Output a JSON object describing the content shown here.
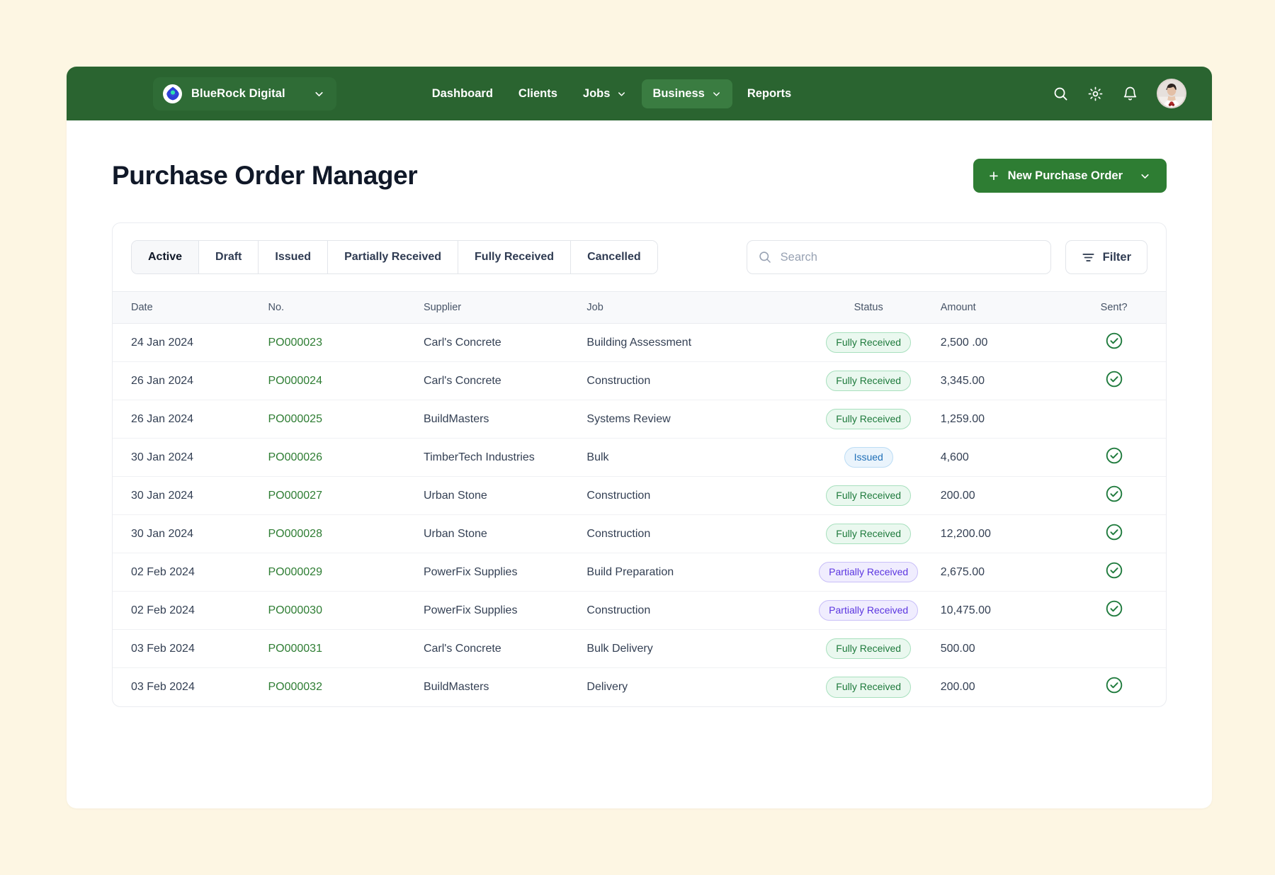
{
  "brand": {
    "name": "BlueRock Digital",
    "logo_icon": "bluerock-logo-icon",
    "caret_icon": "chevron-down-icon"
  },
  "nav": {
    "items": [
      {
        "label": "Dashboard",
        "has_caret": false,
        "active": false
      },
      {
        "label": "Clients",
        "has_caret": false,
        "active": false
      },
      {
        "label": "Jobs",
        "has_caret": true,
        "active": false
      },
      {
        "label": "Business",
        "has_caret": true,
        "active": true
      },
      {
        "label": "Reports",
        "has_caret": false,
        "active": false
      }
    ],
    "right_icons": [
      "search-icon",
      "gear-icon",
      "bell-icon"
    ],
    "avatar": "user-avatar"
  },
  "header": {
    "title": "Purchase Order Manager",
    "new_button_label": "New Purchase Order",
    "new_button_plus": "+",
    "accent_green": "#2E7D33"
  },
  "toolbar": {
    "tabs": [
      {
        "label": "Active",
        "active": true
      },
      {
        "label": "Draft",
        "active": false
      },
      {
        "label": "Issued",
        "active": false
      },
      {
        "label": "Partially Received",
        "active": false
      },
      {
        "label": "Fully Received",
        "active": false
      },
      {
        "label": "Cancelled",
        "active": false
      }
    ],
    "search_placeholder": "Search",
    "search_value": "",
    "filter_label": "Filter"
  },
  "table": {
    "columns": [
      "Date",
      "No.",
      "Supplier",
      "Job",
      "Status",
      "Amount",
      "Sent?"
    ],
    "rows": [
      {
        "date": "24 Jan 2024",
        "no": "PO000023",
        "supplier": "Carl's Concrete",
        "job": "Building Assessment",
        "status": "Fully Received",
        "status_kind": "fully",
        "amount": "2,500 .00",
        "sent": true
      },
      {
        "date": "26 Jan 2024",
        "no": "PO000024",
        "supplier": "Carl's Concrete",
        "job": "Construction",
        "status": "Fully Received",
        "status_kind": "fully",
        "amount": "3,345.00",
        "sent": true
      },
      {
        "date": "26 Jan 2024",
        "no": "PO000025",
        "supplier": "BuildMasters",
        "job": "Systems Review",
        "status": "Fully Received",
        "status_kind": "fully",
        "amount": "1,259.00",
        "sent": false
      },
      {
        "date": "30 Jan 2024",
        "no": "PO000026",
        "supplier": "TimberTech Industries",
        "job": "Bulk",
        "status": "Issued",
        "status_kind": "issued",
        "amount": "4,600",
        "sent": true
      },
      {
        "date": "30 Jan 2024",
        "no": "PO000027",
        "supplier": "Urban Stone",
        "job": "Construction",
        "status": "Fully Received",
        "status_kind": "fully",
        "amount": "200.00",
        "sent": true
      },
      {
        "date": "30 Jan 2024",
        "no": "PO000028",
        "supplier": "Urban Stone",
        "job": "Construction",
        "status": "Fully Received",
        "status_kind": "fully",
        "amount": "12,200.00",
        "sent": true
      },
      {
        "date": "02 Feb 2024",
        "no": "PO000029",
        "supplier": "PowerFix Supplies",
        "job": "Build Preparation",
        "status": "Partially Received",
        "status_kind": "partially",
        "amount": "2,675.00",
        "sent": true
      },
      {
        "date": "02 Feb 2024",
        "no": "PO000030",
        "supplier": "PowerFix Supplies",
        "job": "Construction",
        "status": "Partially Received",
        "status_kind": "partially",
        "amount": "10,475.00",
        "sent": true
      },
      {
        "date": "03 Feb 2024",
        "no": "PO000031",
        "supplier": "Carl's Concrete",
        "job": "Bulk Delivery",
        "status": "Fully Received",
        "status_kind": "fully",
        "amount": "500.00",
        "sent": false
      },
      {
        "date": "03 Feb 2024",
        "no": "PO000032",
        "supplier": "BuildMasters",
        "job": "Delivery",
        "status": "Fully Received",
        "status_kind": "fully",
        "amount": "200.00",
        "sent": true
      }
    ],
    "sent_icon": "check-circle-icon"
  },
  "colors": {
    "page_background": "#FDF6E3",
    "nav_green": "#2A6430",
    "nav_active_green": "#3A7C41",
    "link_green": "#2E7D33",
    "badge_fully": "#1E7A3C",
    "badge_partially": "#5B35E0",
    "badge_issued": "#2070B8"
  }
}
